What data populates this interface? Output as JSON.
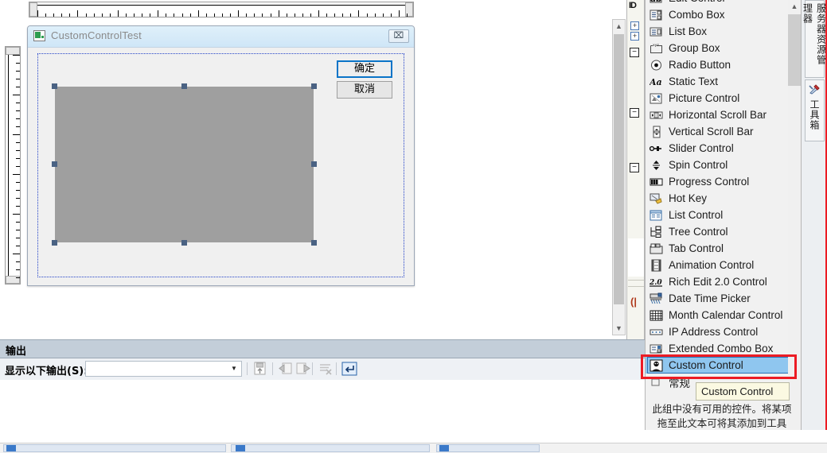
{
  "designer": {
    "dialog": {
      "title": "CustomControlTest",
      "icon": "app-icon",
      "close_label": "⌧",
      "buttons": [
        {
          "id": "ok",
          "label": "确定"
        },
        {
          "id": "cancel",
          "label": "取消"
        }
      ],
      "selected_control": "custom-control-placeholder"
    },
    "rulers": {
      "horizontal": "h-ruler",
      "vertical": "v-ruler"
    }
  },
  "output": {
    "title": "输出",
    "show_label": "显示以下输出(S):",
    "combo_value": "",
    "combo_placeholder": "",
    "toolbar_icons": [
      "save-output-icon",
      "go-to-previous-icon",
      "go-to-next-icon",
      "clear-all-icon",
      "toggle-word-wrap-icon"
    ]
  },
  "toolbox": {
    "items": [
      {
        "label": "Edit Control",
        "icon": "edit-control-icon"
      },
      {
        "label": "Combo Box",
        "icon": "combo-box-icon"
      },
      {
        "label": "List Box",
        "icon": "list-box-icon"
      },
      {
        "label": "Group Box",
        "icon": "group-box-icon"
      },
      {
        "label": "Radio Button",
        "icon": "radio-button-icon"
      },
      {
        "label": "Static Text",
        "icon": "static-text-icon"
      },
      {
        "label": "Picture Control",
        "icon": "picture-control-icon"
      },
      {
        "label": "Horizontal Scroll Bar",
        "icon": "horizontal-scroll-bar-icon"
      },
      {
        "label": "Vertical Scroll Bar",
        "icon": "vertical-scroll-bar-icon"
      },
      {
        "label": "Slider Control",
        "icon": "slider-control-icon"
      },
      {
        "label": "Spin Control",
        "icon": "spin-control-icon"
      },
      {
        "label": "Progress Control",
        "icon": "progress-control-icon"
      },
      {
        "label": "Hot Key",
        "icon": "hot-key-icon"
      },
      {
        "label": "List Control",
        "icon": "list-control-icon"
      },
      {
        "label": "Tree Control",
        "icon": "tree-control-icon"
      },
      {
        "label": "Tab Control",
        "icon": "tab-control-icon"
      },
      {
        "label": "Animation Control",
        "icon": "animation-control-icon"
      },
      {
        "label": "Rich Edit 2.0 Control",
        "icon": "rich-edit-control-icon"
      },
      {
        "label": "Date Time Picker",
        "icon": "date-time-picker-icon"
      },
      {
        "label": "Month Calendar Control",
        "icon": "month-calendar-icon"
      },
      {
        "label": "IP Address Control",
        "icon": "ip-address-icon"
      },
      {
        "label": "Extended Combo Box",
        "icon": "extended-combo-box-icon"
      },
      {
        "label": "Custom Control",
        "icon": "custom-control-icon",
        "selected": true
      },
      {
        "label": "常规",
        "icon": "group-collapsed-icon"
      }
    ],
    "tooltip": "Custom Control",
    "empty_group_note": "此组中没有可用的控件。将某项拖至此文本可将其添加到工具箱。"
  },
  "vertical_tabs": [
    {
      "label": "服务器资源管理器",
      "icon": "server-explorer-icon"
    },
    {
      "label": "工具箱",
      "icon": "toolbox-icon"
    }
  ],
  "colors": {
    "highlight_red": "#ec1c24",
    "selection_blue": "#8fc6ef",
    "handle_blue": "#4a6283",
    "control_gray": "#9f9f9f",
    "accent_button_border": "#0a74c8",
    "tooltip_bg": "#fbf9e2"
  }
}
